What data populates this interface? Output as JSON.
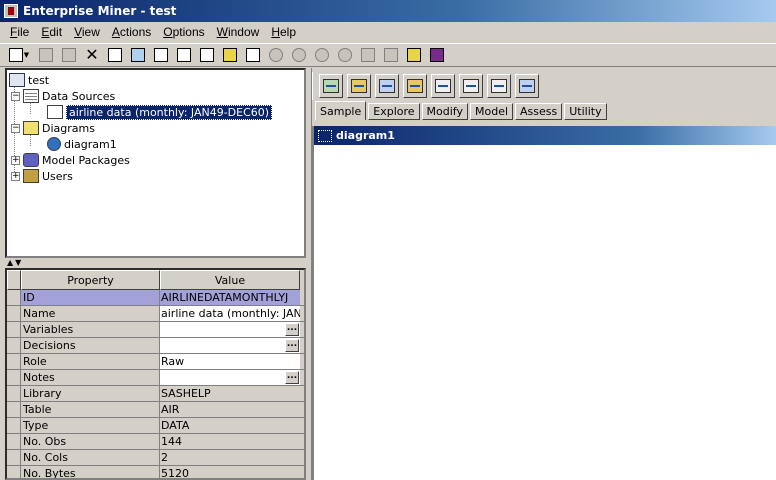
{
  "window": {
    "title": "Enterprise Miner - test"
  },
  "menu": [
    {
      "label": "File",
      "u": "F",
      "rest": "ile"
    },
    {
      "label": "Edit",
      "u": "E",
      "rest": "dit"
    },
    {
      "label": "View",
      "u": "V",
      "rest": "iew"
    },
    {
      "label": "Actions",
      "u": "A",
      "rest": "ctions"
    },
    {
      "label": "Options",
      "u": "O",
      "rest": "ptions"
    },
    {
      "label": "Window",
      "u": "W",
      "rest": "indow"
    },
    {
      "label": "Help",
      "u": "H",
      "rest": "elp"
    }
  ],
  "toolbar": {
    "icons": [
      "new-document-icon",
      "copy-icon",
      "paste-icon",
      "delete-icon",
      "select-icon",
      "connect-icon",
      "run-icon",
      "view-results-icon",
      "properties-icon",
      "explore-icon",
      "chart-icon",
      "run-path-icon",
      "stop-icon",
      "pause-icon",
      "refresh-icon",
      "layout-icon",
      "zoom-icon",
      "settings-icon",
      "help-book-icon"
    ]
  },
  "tree": {
    "root": "test",
    "data_sources": "Data Sources",
    "datasource_item": "airline data (monthly: JAN49-DEC60)",
    "diagrams": "Diagrams",
    "diagram_item": "diagram1",
    "model_packages": "Model Packages",
    "users": "Users"
  },
  "properties": {
    "header_property": "Property",
    "header_value": "Value",
    "rows": [
      {
        "name": "ID",
        "value": "AIRLINEDATAMONTHLYJ"
      },
      {
        "name": "Name",
        "value": "airline data (monthly: JAN"
      },
      {
        "name": "Variables",
        "value": ""
      },
      {
        "name": "Decisions",
        "value": ""
      },
      {
        "name": "Role",
        "value": "Raw"
      },
      {
        "name": "Notes",
        "value": ""
      },
      {
        "name": "Library",
        "value": "SASHELP"
      },
      {
        "name": "Table",
        "value": "AIR"
      },
      {
        "name": "Type",
        "value": "DATA"
      },
      {
        "name": "No. Obs",
        "value": "144"
      },
      {
        "name": "No. Cols",
        "value": "2"
      },
      {
        "name": "No. Bytes",
        "value": "5120"
      }
    ]
  },
  "node_tools": [
    "input-data-node-icon",
    "sample-node-icon",
    "filter-node-icon",
    "partition-node-icon",
    "file-import-icon",
    "merge-node-icon",
    "append-node-icon",
    "time-series-icon"
  ],
  "tabs": [
    "Sample",
    "Explore",
    "Modify",
    "Model",
    "Assess",
    "Utility"
  ],
  "diagram": {
    "title": "diagram1"
  }
}
